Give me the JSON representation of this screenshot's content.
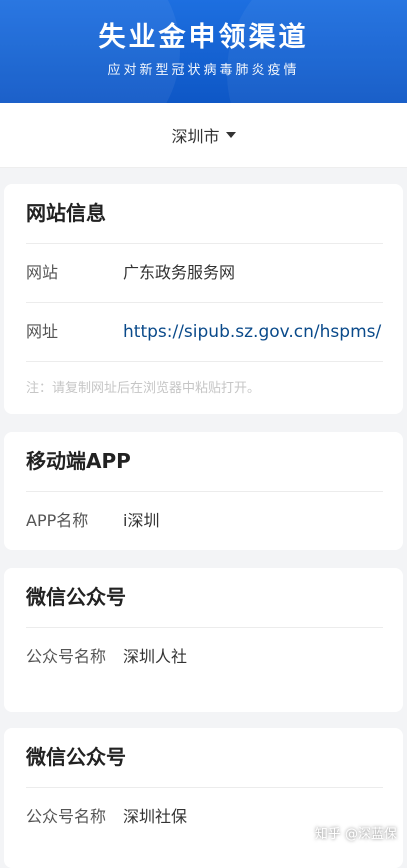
{
  "banner": {
    "title": "失业金申领渠道",
    "subtitle": "应对新型冠状病毒肺炎疫情"
  },
  "city_selector": {
    "label": "深圳市"
  },
  "cards": [
    {
      "title": "网站信息",
      "rows": [
        {
          "key": "网站",
          "value": "广东政务服务网"
        },
        {
          "key": "网址",
          "value": "https://sipub.sz.gov.cn/hspms/"
        }
      ],
      "note": "注：请复制网址后在浏览器中粘贴打开。"
    },
    {
      "title": "移动端APP",
      "rows": [
        {
          "key": "APP名称",
          "value": "i深圳"
        }
      ]
    },
    {
      "title": "微信公众号",
      "rows": [
        {
          "key": "公众号名称",
          "value": "深圳人社"
        }
      ]
    },
    {
      "title": "微信公众号",
      "rows": [
        {
          "key": "公众号名称",
          "value": "深圳社保"
        }
      ]
    }
  ],
  "watermark": "知乎 @深蓝保",
  "colors": {
    "banner": "#1565d8",
    "link": "#0a4a8a",
    "background": "#f3f4f6"
  }
}
